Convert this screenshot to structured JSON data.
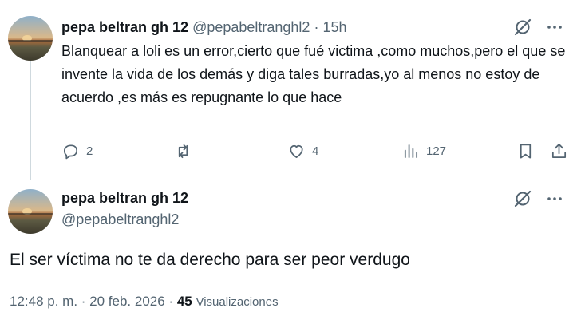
{
  "reply_tweet": {
    "author_name": "pepa beltran gh 12",
    "handle": "@pepabeltranghl2",
    "separator": "·",
    "time": "15h",
    "text": "Blanquear a loli es un error,cierto que fué victima ,como muchos,pero el que se invente la vida de los demás  y diga tales burradas,yo al menos no estoy de acuerdo ,es más es repugnante lo que hace",
    "actions": {
      "replies": "2",
      "reposts": "",
      "likes": "4",
      "views": "127"
    }
  },
  "main_tweet": {
    "author_name": "pepa beltran gh 12",
    "handle": "@pepabeltranghl2",
    "text": "El ser víctima no te da derecho para ser peor verdugo",
    "timestamp": "12:48 p. m. · 20 feb. 2026 ·",
    "view_count": "45",
    "views_label": "Visualizaciones"
  },
  "icons": {
    "grok": "grok-icon",
    "more": "more-options-icon",
    "reply": "reply-icon",
    "repost": "repost-icon",
    "like": "like-icon",
    "views": "views-icon",
    "bookmark": "bookmark-icon",
    "share": "share-icon"
  },
  "colors": {
    "text_primary": "#0f1419",
    "text_secondary": "#536471",
    "divider": "#cfd9de"
  }
}
